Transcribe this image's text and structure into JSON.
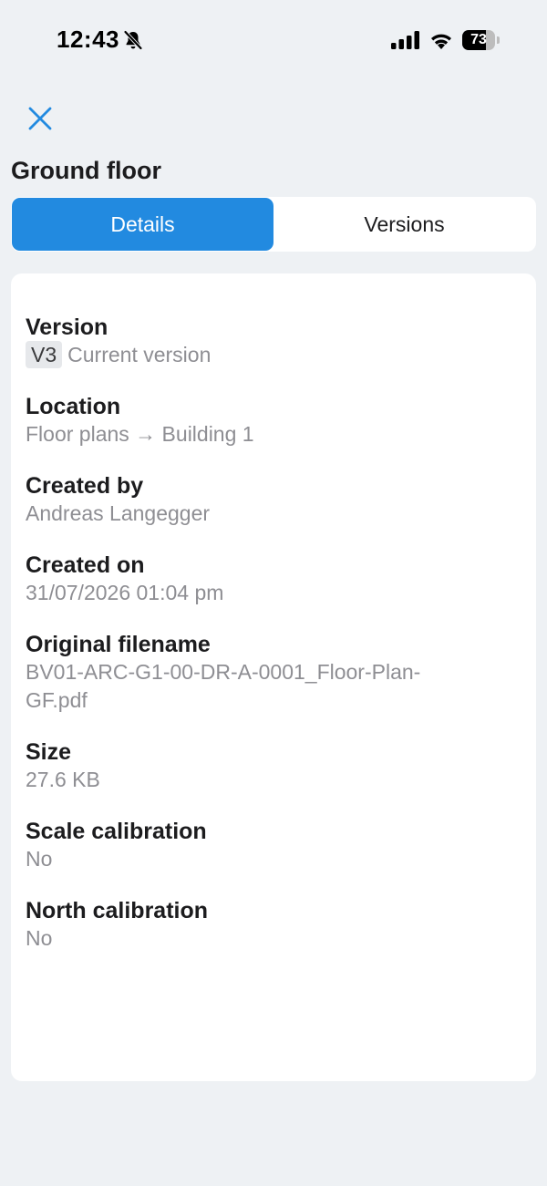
{
  "status_bar": {
    "time": "12:43",
    "battery": "73",
    "battery_level": 0.73
  },
  "header": {
    "title": "Ground floor"
  },
  "tabs": [
    {
      "label": "Details",
      "active": true
    },
    {
      "label": "Versions",
      "active": false
    }
  ],
  "details": {
    "version": {
      "label": "Version",
      "badge": "V3",
      "value": "Current version"
    },
    "location": {
      "label": "Location",
      "value": "Floor plans → Building 1"
    },
    "created_by": {
      "label": "Created by",
      "value": "Andreas Langegger"
    },
    "created_on": {
      "label": "Created on",
      "value": "31/07/2026 01:04 pm"
    },
    "original_filename": {
      "label": "Original filename",
      "value": "BV01-ARC-G1-00-DR-A-0001_Floor-Plan-GF.pdf"
    },
    "size": {
      "label": "Size",
      "value": "27.6 KB"
    },
    "scale_calibration": {
      "label": "Scale calibration",
      "value": "No"
    },
    "north_calibration": {
      "label": "North calibration",
      "value": "No"
    }
  },
  "colors": {
    "accent": "#228ae0",
    "background": "#eef1f4",
    "card": "#ffffff",
    "secondary_text": "#8e8e93"
  }
}
